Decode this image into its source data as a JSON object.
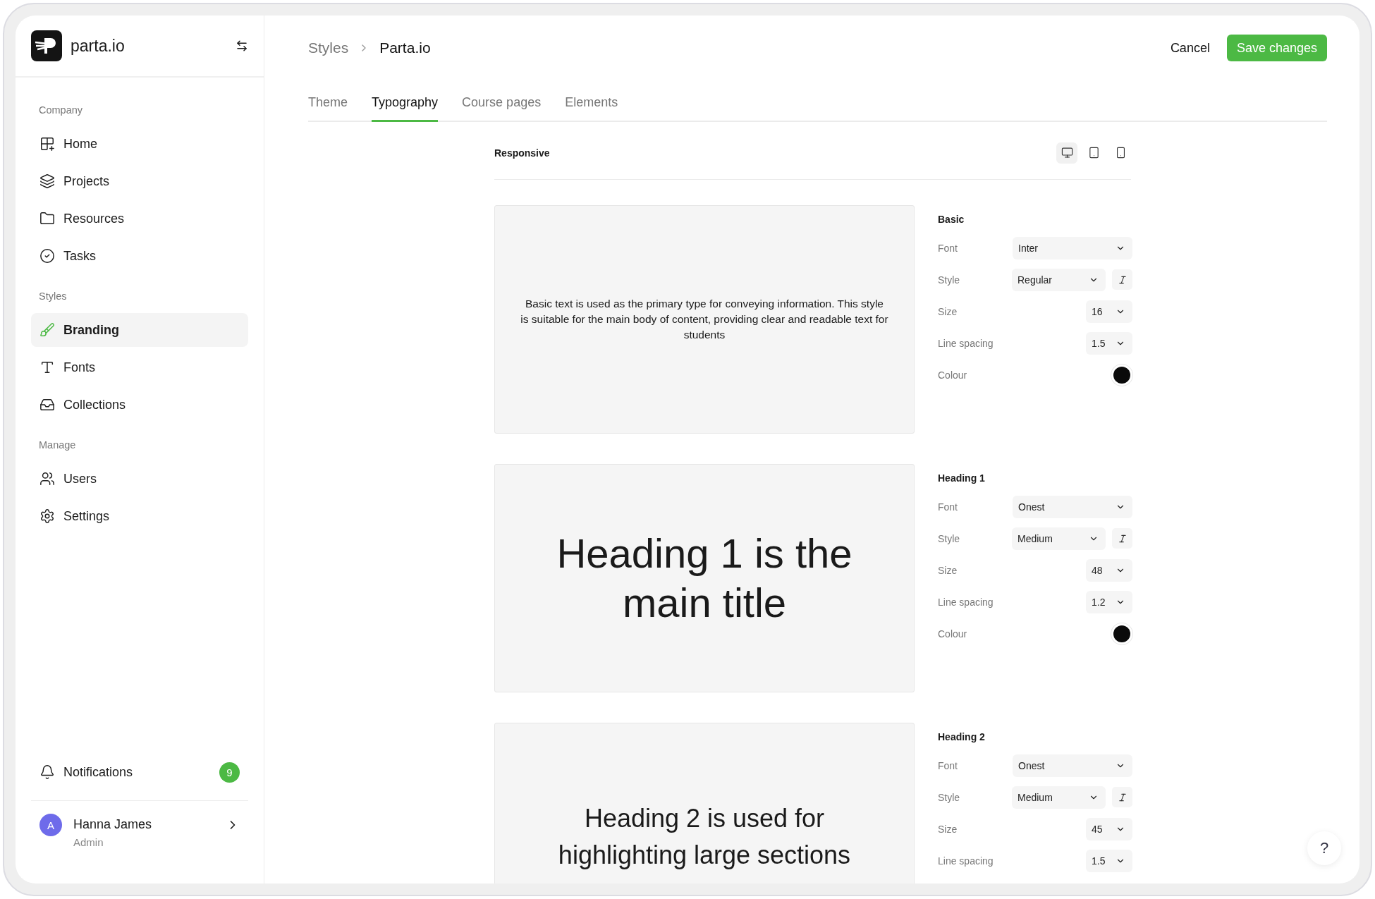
{
  "sidebar": {
    "brand": "parta.io",
    "sections": [
      {
        "label": "Company",
        "items": [
          {
            "label": "Home",
            "selected": false
          },
          {
            "label": "Projects",
            "selected": false
          },
          {
            "label": "Resources",
            "selected": false
          },
          {
            "label": "Tasks",
            "selected": false
          }
        ]
      },
      {
        "label": "Styles",
        "items": [
          {
            "label": "Branding",
            "selected": true
          },
          {
            "label": "Fonts",
            "selected": false
          },
          {
            "label": "Collections",
            "selected": false
          }
        ]
      },
      {
        "label": "Manage",
        "items": [
          {
            "label": "Users",
            "selected": false
          },
          {
            "label": "Settings",
            "selected": false
          }
        ]
      }
    ],
    "notifications": {
      "label": "Notifications",
      "count": "9"
    },
    "user": {
      "initial": "A",
      "name": "Hanna James",
      "role": "Admin"
    }
  },
  "breadcrumb": [
    "Styles",
    "Parta.io"
  ],
  "actions": {
    "cancel": "Cancel",
    "save": "Save changes"
  },
  "tabs": [
    {
      "label": "Theme",
      "selected": false
    },
    {
      "label": "Typography",
      "selected": true
    },
    {
      "label": "Course pages",
      "selected": false
    },
    {
      "label": "Elements",
      "selected": false
    }
  ],
  "responsive": {
    "label": "Responsive",
    "devices": [
      {
        "kind": "desktop",
        "selected": true
      },
      {
        "kind": "tablet",
        "selected": false
      },
      {
        "kind": "mobile",
        "selected": false
      }
    ]
  },
  "styles": [
    {
      "title": "Basic",
      "kind": "body",
      "preview": "Basic text is used as the primary type for conveying information. This style is suitable for the main body of content, providing clear and readable text for students",
      "settings": [
        {
          "kind": "font",
          "label": "Font",
          "value": "Inter"
        },
        {
          "kind": "style",
          "label": "Style",
          "value": "Regular"
        },
        {
          "kind": "number",
          "label": "Size",
          "value": "16"
        },
        {
          "kind": "number",
          "label": "Line spacing",
          "value": "1.5"
        },
        {
          "kind": "colour",
          "label": "Colour",
          "color": "#0a0a0a"
        }
      ]
    },
    {
      "title": "Heading 1",
      "kind": "heading1",
      "preview": "Heading 1 is the main title",
      "settings": [
        {
          "kind": "font",
          "label": "Font",
          "value": "Onest"
        },
        {
          "kind": "style",
          "label": "Style",
          "value": "Medium"
        },
        {
          "kind": "number",
          "label": "Size",
          "value": "48"
        },
        {
          "kind": "number",
          "label": "Line spacing",
          "value": "1.2"
        },
        {
          "kind": "colour",
          "label": "Colour",
          "color": "#0a0a0a"
        }
      ]
    },
    {
      "title": "Heading 2",
      "kind": "heading2",
      "preview": "Heading 2 is used for highlighting large sections",
      "settings": [
        {
          "kind": "font",
          "label": "Font",
          "value": "Onest"
        },
        {
          "kind": "style",
          "label": "Style",
          "value": "Medium"
        },
        {
          "kind": "number",
          "label": "Size",
          "value": "45"
        },
        {
          "kind": "number",
          "label": "Line spacing",
          "value": "1.5"
        }
      ]
    }
  ],
  "help": "?"
}
